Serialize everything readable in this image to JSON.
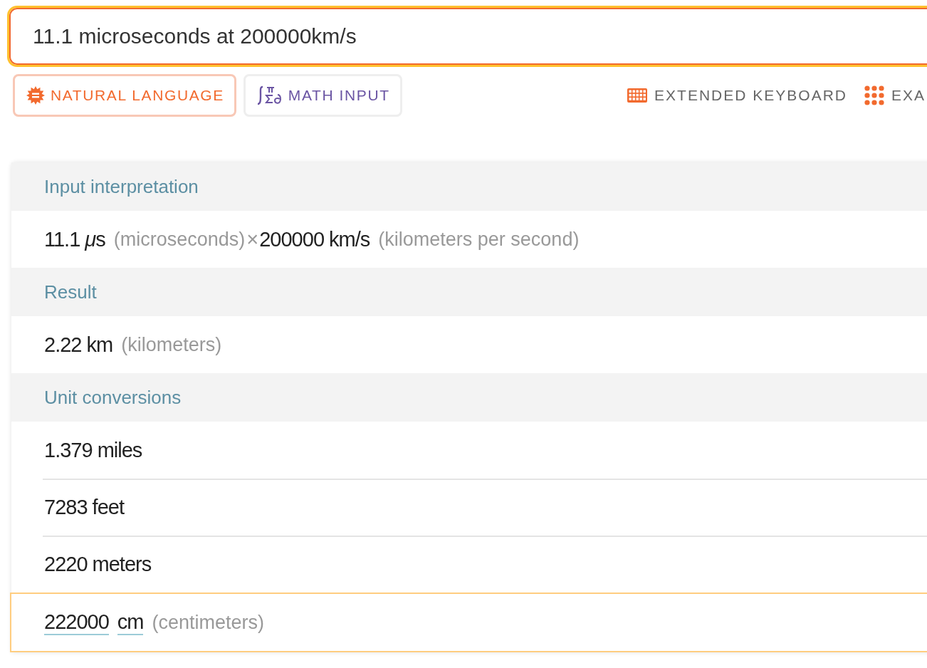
{
  "search": {
    "value": "11.1 microseconds at 200000km/s"
  },
  "modes": [
    {
      "label": "NATURAL LANGUAGE",
      "kind": "natural",
      "selected": true
    },
    {
      "label": "MATH INPUT",
      "kind": "math",
      "selected": false
    }
  ],
  "tools": [
    {
      "label": "EXTENDED KEYBOARD",
      "kind": "keyboard"
    },
    {
      "label": "EXA",
      "kind": "examples"
    }
  ],
  "pods": [
    {
      "title": "Input interpretation",
      "rows": [
        {
          "highlighted": false,
          "segments": [
            {
              "kind": "value",
              "parts": [
                {
                  "text": "11.1 ",
                  "italic": false
                },
                {
                  "text": "μ",
                  "italic": true
                },
                {
                  "text": "s",
                  "italic": false
                }
              ]
            },
            {
              "kind": "note",
              "text": "(microseconds)"
            },
            {
              "kind": "operator",
              "text": "×"
            },
            {
              "kind": "value",
              "text": "200000 km/s"
            },
            {
              "kind": "note",
              "text": "(kilometers per second)"
            }
          ]
        }
      ]
    },
    {
      "title": "Result",
      "rows": [
        {
          "highlighted": false,
          "segments": [
            {
              "kind": "value",
              "text": "2.22 km"
            },
            {
              "kind": "note",
              "text": "(kilometers)"
            }
          ]
        }
      ]
    },
    {
      "title": "Unit conversions",
      "rows": [
        {
          "highlighted": false,
          "segments": [
            {
              "kind": "value",
              "text": "1.379 miles"
            }
          ]
        },
        {
          "highlighted": false,
          "segments": [
            {
              "kind": "value",
              "text": "7283 feet"
            }
          ]
        },
        {
          "highlighted": false,
          "segments": [
            {
              "kind": "value",
              "text": "2220 meters"
            }
          ]
        },
        {
          "highlighted": true,
          "segments": [
            {
              "kind": "link",
              "text": "222000"
            },
            {
              "kind": "link",
              "text": "cm"
            },
            {
              "kind": "note",
              "text": "(centimeters)"
            }
          ]
        }
      ]
    }
  ]
}
